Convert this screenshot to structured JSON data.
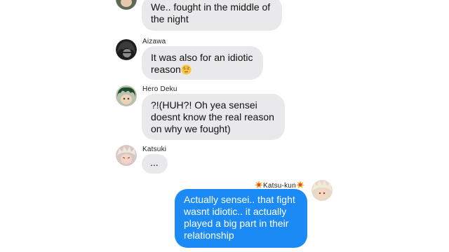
{
  "conversation": {
    "messages": [
      {
        "id": "m1",
        "sender": "",
        "direction": "incoming",
        "lines": [
          "We.. fought in the middle of",
          "the night"
        ]
      },
      {
        "id": "m2",
        "sender": "Aizawa",
        "direction": "incoming",
        "lines": [
          "It was also for an idiotic",
          "reason"
        ],
        "trailing_emoji": "relieved-face-emoji"
      },
      {
        "id": "m3",
        "sender": "Hero Deku",
        "direction": "incoming",
        "lines": [
          "?!(HUH?! Oh yea sensei",
          "doesnt know the real reason",
          "on why we fought)"
        ]
      },
      {
        "id": "m4",
        "sender": "Katsuki",
        "direction": "incoming",
        "lines": [
          "..."
        ]
      },
      {
        "id": "m5",
        "sender": "Katsu-kun",
        "sender_flair": "explosion-emoji",
        "direction": "outgoing",
        "lines": [
          "Actually sensei.. that fight",
          "wasnt idiotic.. it actually",
          "played a big part in their",
          "relationship"
        ]
      }
    ]
  },
  "colors": {
    "incoming_bubble": "#e9e9eb",
    "outgoing_bubble": "#1b8af5",
    "background": "#ffffff"
  }
}
